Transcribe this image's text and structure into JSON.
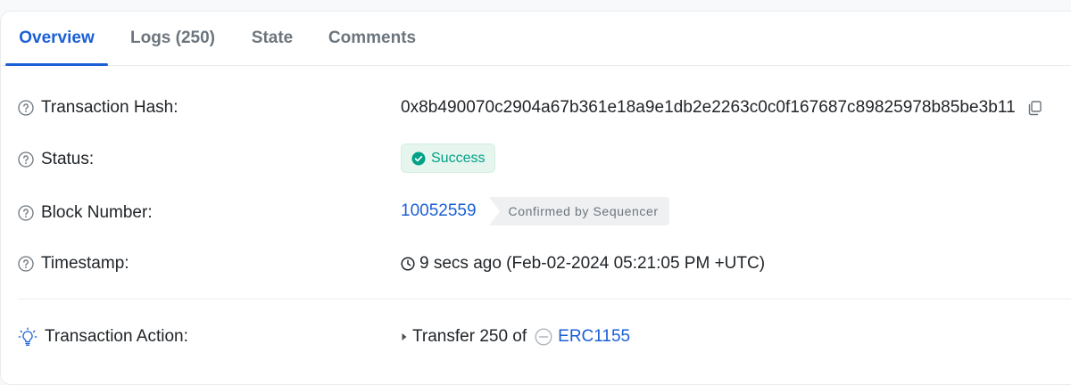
{
  "tabs": [
    {
      "label": "Overview"
    },
    {
      "label": "Logs (250)"
    },
    {
      "label": "State"
    },
    {
      "label": "Comments"
    }
  ],
  "rows": {
    "tx_hash": {
      "label": "Transaction Hash:",
      "value": "0x8b490070c2904a67b361e18a9e1db2e2263c0c0f167687c89825978b85be3b11"
    },
    "status": {
      "label": "Status:",
      "value": "Success"
    },
    "block": {
      "label": "Block Number:",
      "value": "10052559",
      "confirm": "Confirmed by Sequencer"
    },
    "timestamp": {
      "label": "Timestamp:",
      "value": "9 secs ago (Feb-02-2024 05:21:05 PM +UTC)"
    },
    "action": {
      "label": "Transaction Action:",
      "prefix": "Transfer 250 of",
      "token": "ERC1155"
    }
  },
  "colors": {
    "accent": "#1b5fd6",
    "success": "#00a186",
    "muted": "#6c757d"
  },
  "icons": {
    "help": "question-circle-icon",
    "copy": "copy-icon",
    "success": "check-circle-icon",
    "clock": "clock-icon",
    "action": "lightbulb-icon",
    "caret": "caret-right-icon",
    "token": "token-placeholder-icon"
  }
}
